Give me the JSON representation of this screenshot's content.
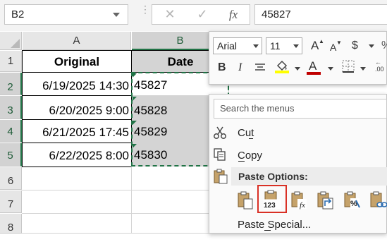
{
  "formula_bar": {
    "name_box": "B2",
    "formula": "45827",
    "cancel_symbol": "✕",
    "enter_symbol": "✓",
    "fx_symbol": "fx"
  },
  "columns": [
    "A",
    "B"
  ],
  "rows": [
    "1",
    "2",
    "3",
    "4",
    "5",
    "6",
    "7",
    "8"
  ],
  "sheet": {
    "header_original": "Original",
    "header_date": "Date",
    "original_values": [
      "6/19/2025 14:30",
      "6/20/2025 9:00",
      "6/21/2025 17:45",
      "6/22/2025 8:00"
    ],
    "date_values": [
      "45827",
      "45828",
      "45829",
      "45830"
    ]
  },
  "mini_toolbar": {
    "font_name": "Arial",
    "font_size": "11",
    "grow_font": "A",
    "shrink_font": "A",
    "currency": "$",
    "bold": "B",
    "italic": "I",
    "font_color_letter": "A",
    "highlight_color": "#ffff00",
    "font_color": "#c00000"
  },
  "context_menu": {
    "search_placeholder": "Search the menus",
    "cut": "Cut",
    "copy": "Copy",
    "paste_options_label": "Paste Options:",
    "paste_special": "Paste Special...",
    "paste_values_label": "123"
  },
  "colors": {
    "excel_green": "#217346",
    "highlight_border": "#d93025"
  }
}
